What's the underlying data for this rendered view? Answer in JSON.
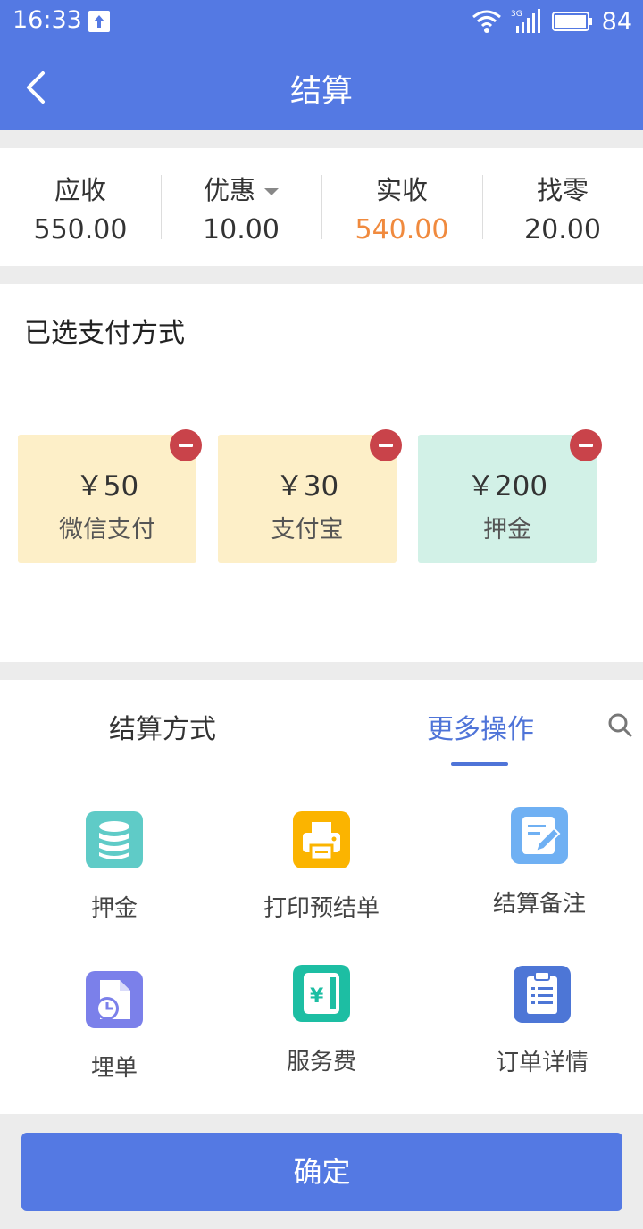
{
  "status_bar": {
    "time": "16:33",
    "network": "3G",
    "battery": "84"
  },
  "header": {
    "title": "结算"
  },
  "summary": [
    {
      "label": "应收",
      "value": "550.00"
    },
    {
      "label": "优惠",
      "value": "10.00"
    },
    {
      "label": "实收",
      "value": "540.00"
    },
    {
      "label": "找零",
      "value": "20.00"
    }
  ],
  "selected": {
    "heading": "已选支付方式",
    "cards": [
      {
        "amount": "￥50",
        "name": "微信支付"
      },
      {
        "amount": "￥30",
        "name": "支付宝"
      },
      {
        "amount": "￥200",
        "name": "押金"
      }
    ]
  },
  "tabs": [
    {
      "label": "结算方式"
    },
    {
      "label": "更多操作"
    }
  ],
  "operations": [
    {
      "label": "押金",
      "icon": "database-icon"
    },
    {
      "label": "打印预结单",
      "icon": "printer-icon"
    },
    {
      "label": "结算备注",
      "icon": "note-edit-icon"
    },
    {
      "label": "埋单",
      "icon": "document-clock-icon"
    },
    {
      "label": "服务费",
      "icon": "yen-document-icon"
    },
    {
      "label": "订单详情",
      "icon": "clipboard-list-icon"
    }
  ],
  "footer": {
    "confirm_label": "确定"
  },
  "colors": {
    "primary": "#5479e3",
    "accent": "#f08a3e",
    "remove": "#c9434a"
  }
}
